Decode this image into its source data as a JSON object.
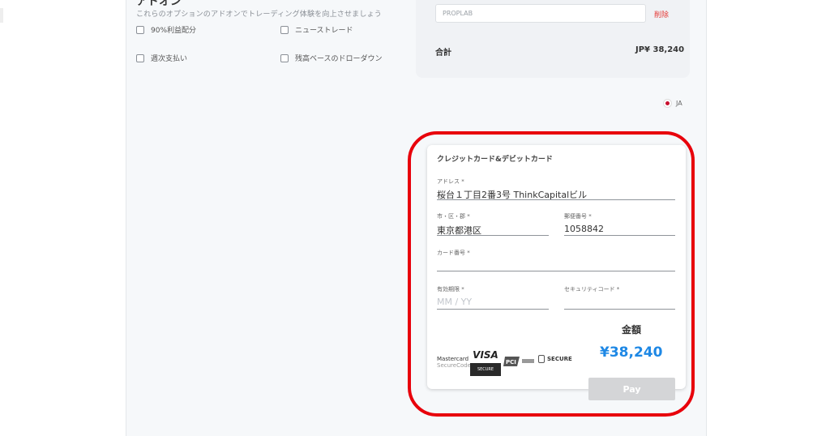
{
  "addons": {
    "title": "アドオン",
    "subtitle": "これらのオプションのアドオンでトレーディング体験を向上させましょう",
    "options": [
      {
        "label": "90%利益配分",
        "checked": false
      },
      {
        "label": "ニューストレード",
        "checked": false
      },
      {
        "label": "週次支払い",
        "checked": false
      },
      {
        "label": "残高ベースのドローダウン",
        "checked": false
      }
    ]
  },
  "summary": {
    "coupon_value": "PROPLAB",
    "delete_label": "削除",
    "total_label": "合計",
    "total_value": "JP¥ 38,240"
  },
  "language": {
    "code": "JA",
    "flag": "japan-flag-icon"
  },
  "payment": {
    "title": "クレジットカード&デビットカード",
    "fields": {
      "address": {
        "label": "アドレス *",
        "value": "桜台１丁目2番3号 ThinkCapitalビル"
      },
      "city": {
        "label": "市・区・郡 *",
        "value": "東京都港区"
      },
      "postal": {
        "label": "郵便番号 *",
        "value": "1058842"
      },
      "card_number": {
        "label": "カード番号 *",
        "value": ""
      },
      "expiry": {
        "label": "有効期限 *",
        "placeholder": "MM / YY"
      },
      "cvc": {
        "label": "セキュリティコード *",
        "value": ""
      }
    },
    "amount_label": "金額",
    "amount_value": "¥38,240",
    "pay_label": "Pay",
    "logos": {
      "mastercard_line1": "Mastercard",
      "mastercard_line2": "SecureCode",
      "visa": "VISA",
      "visa_secure": "SECURE",
      "pci": "PCI",
      "secure": "SECURE"
    },
    "colors": {
      "amount": "#1e88e5",
      "highlight": "#e8000b",
      "delete": "#e53935"
    }
  }
}
